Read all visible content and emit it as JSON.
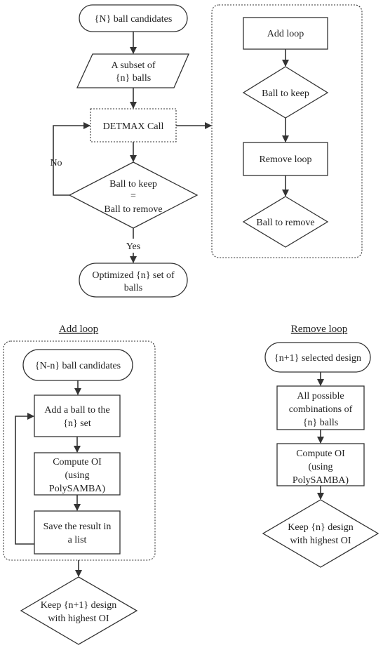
{
  "main": {
    "start": "{N} ball candidates",
    "subset": [
      "A subset of",
      "{n} balls"
    ],
    "detmax": "DETMAX Call",
    "decision": [
      "Ball to keep",
      "=",
      "Ball to remove"
    ],
    "no_label": "No",
    "yes_label": "Yes",
    "end": [
      "Optimized {n} set of",
      "balls"
    ]
  },
  "detmax_detail": {
    "add_loop": "Add loop",
    "ball_to_keep": "Ball to keep",
    "remove_loop": "Remove loop",
    "ball_to_remove": "Ball to remove"
  },
  "add_loop": {
    "title": "Add loop",
    "start": "{N-n} ball candidates",
    "step1": [
      "Add a ball to the",
      "{n} set"
    ],
    "step2": [
      "Compute OI",
      "(using",
      "PolySAMBA)"
    ],
    "step3": [
      "Save the result in",
      "a list"
    ],
    "result": [
      "Keep {n+1} design",
      "with highest OI"
    ]
  },
  "remove_loop": {
    "title": "Remove loop",
    "start": "{n+1} selected design",
    "step1": [
      "All possible",
      "combinations of",
      "{n} balls"
    ],
    "step2": [
      "Compute OI",
      "(using",
      "PolySAMBA)"
    ],
    "result": [
      "Keep {n} design",
      "with highest OI"
    ]
  }
}
